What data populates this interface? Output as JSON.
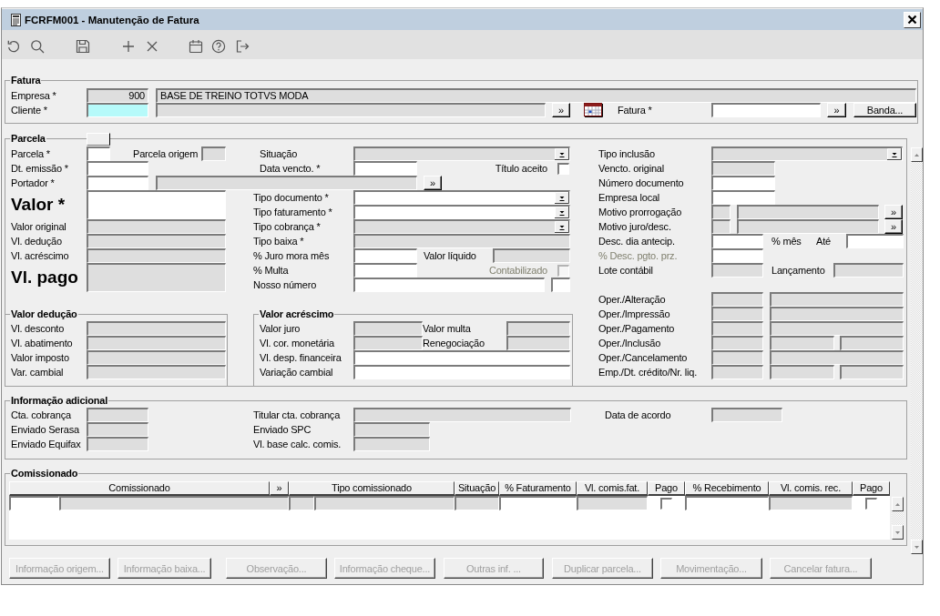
{
  "window": {
    "title": "FCRFM001 - Manutenção de Fatura"
  },
  "fatura": {
    "legend": "Fatura",
    "rows": [
      [
        {
          "kind": "label",
          "text": "Empresa *"
        },
        {
          "kind": "text",
          "value": "900",
          "disabled": true
        },
        {
          "kind": "text",
          "value": "BASE DE TREINO TOTVS MODA",
          "disabled": true
        }
      ],
      [
        {
          "kind": "label",
          "text": "Cliente *"
        },
        {
          "kind": "text",
          "disabled": false,
          "focused": true
        },
        {
          "kind": "text",
          "disabled": true
        },
        {
          "kind": "button",
          "text": "»",
          "disabled": false
        },
        {
          "kind": "calendar"
        },
        {
          "kind": "label",
          "text": "Fatura *"
        },
        {
          "kind": "text",
          "disabled": false
        },
        {
          "kind": "button",
          "text": "»",
          "disabled": false
        },
        {
          "kind": "button",
          "text": "Banda...",
          "disabled": false
        }
      ]
    ]
  },
  "parcela": {
    "legend": "Parcela",
    "left": [
      [
        {
          "kind": "label",
          "text": "Parcela *"
        },
        {
          "kind": "text",
          "disabled": false
        },
        {
          "kind": "label",
          "text": "Parcela origem"
        },
        {
          "kind": "text",
          "disabled": true
        }
      ],
      [
        {
          "kind": "label",
          "text": "Dt. emissão *"
        },
        {
          "kind": "text",
          "disabled": false
        }
      ],
      [
        {
          "kind": "label",
          "text": "Portador *"
        },
        {
          "kind": "text",
          "disabled": false
        },
        {
          "kind": "text",
          "disabled": true
        },
        {
          "kind": "button",
          "text": "»",
          "disabled": false
        }
      ],
      [
        {
          "kind": "heading",
          "text": "Valor *"
        },
        {
          "kind": "text",
          "disabled": false
        }
      ],
      [
        {
          "kind": "label",
          "text": "Valor original"
        },
        {
          "kind": "text",
          "disabled": true
        }
      ],
      [
        {
          "kind": "label",
          "text": "Vl. dedução"
        },
        {
          "kind": "text",
          "disabled": true
        }
      ],
      [
        {
          "kind": "label",
          "text": "Vl. acréscimo"
        },
        {
          "kind": "text",
          "disabled": true
        }
      ],
      [
        {
          "kind": "heading",
          "text": "Vl. pago"
        },
        {
          "kind": "text",
          "disabled": true
        }
      ]
    ],
    "deducao": {
      "legend": "Valor dedução",
      "rows": [
        [
          {
            "kind": "label",
            "text": "Vl. desconto"
          },
          {
            "kind": "text",
            "disabled": true
          }
        ],
        [
          {
            "kind": "label",
            "text": "Vl. abatimento"
          },
          {
            "kind": "text",
            "disabled": true
          }
        ],
        [
          {
            "kind": "label",
            "text": "Valor imposto"
          },
          {
            "kind": "text",
            "disabled": true
          }
        ],
        [
          {
            "kind": "label",
            "text": "Var. cambial"
          },
          {
            "kind": "text",
            "disabled": true
          }
        ]
      ]
    },
    "middle": [
      [
        {
          "kind": "label",
          "text": "Situação"
        },
        {
          "kind": "dropdown",
          "disabled": true
        }
      ],
      [
        {
          "kind": "label",
          "text": "Data vencto. *"
        },
        {
          "kind": "text",
          "disabled": false
        },
        {
          "kind": "label",
          "text": "Título aceito"
        },
        {
          "kind": "checkbox",
          "checked": false,
          "disabled": false
        }
      ],
      [
        {
          "kind": "label",
          "text": "Tipo documento *"
        },
        {
          "kind": "dropdown",
          "disabled": false
        }
      ],
      [
        {
          "kind": "label",
          "text": "Tipo faturamento *"
        },
        {
          "kind": "dropdown",
          "disabled": false
        }
      ],
      [
        {
          "kind": "label",
          "text": "Tipo cobrança *"
        },
        {
          "kind": "dropdown",
          "disabled": true
        }
      ],
      [
        {
          "kind": "label",
          "text": "Tipo baixa *"
        },
        {
          "kind": "text",
          "disabled": true
        }
      ],
      [
        {
          "kind": "label",
          "text": "% Juro mora mês"
        },
        {
          "kind": "text",
          "disabled": false
        },
        {
          "kind": "label",
          "text": "Valor líquido"
        },
        {
          "kind": "text",
          "disabled": true
        }
      ],
      [
        {
          "kind": "label",
          "text": "% Multa"
        },
        {
          "kind": "text",
          "disabled": false
        },
        {
          "kind": "label",
          "text": "Contabilizado",
          "disabled": true
        },
        {
          "kind": "checkbox",
          "checked": false,
          "disabled": true
        }
      ],
      [
        {
          "kind": "label",
          "text": "Nosso número"
        },
        {
          "kind": "text",
          "disabled": false
        },
        {
          "kind": "text",
          "disabled": false
        }
      ]
    ],
    "acrescimo": {
      "legend": "Valor acréscimo",
      "rows": [
        [
          {
            "kind": "label",
            "text": "Valor juro"
          },
          {
            "kind": "text",
            "disabled": true
          },
          {
            "kind": "label",
            "text": "Valor multa"
          },
          {
            "kind": "text",
            "disabled": true
          }
        ],
        [
          {
            "kind": "label",
            "text": "Vl. cor. monetária"
          },
          {
            "kind": "text",
            "disabled": true
          },
          {
            "kind": "label",
            "text": "Renegociação"
          },
          {
            "kind": "text",
            "disabled": true
          }
        ],
        [
          {
            "kind": "label",
            "text": "Vl. desp. financeira"
          },
          {
            "kind": "text",
            "disabled": false
          }
        ],
        [
          {
            "kind": "label",
            "text": "Variação cambial"
          },
          {
            "kind": "text",
            "disabled": false
          }
        ]
      ]
    },
    "right": [
      [
        {
          "kind": "label",
          "text": "Tipo inclusão"
        },
        {
          "kind": "dropdown",
          "disabled": true
        }
      ],
      [
        {
          "kind": "label",
          "text": "Vencto. original"
        },
        {
          "kind": "text",
          "disabled": true
        }
      ],
      [
        {
          "kind": "label",
          "text": "Número documento"
        },
        {
          "kind": "text",
          "disabled": false
        }
      ],
      [
        {
          "kind": "label",
          "text": "Empresa local"
        },
        {
          "kind": "text",
          "disabled": false
        }
      ],
      [
        {
          "kind": "label",
          "text": "Motivo prorrogação"
        },
        {
          "kind": "text",
          "disabled": true
        },
        {
          "kind": "text",
          "disabled": true
        },
        {
          "kind": "button",
          "text": "»",
          "disabled": false
        }
      ],
      [
        {
          "kind": "label",
          "text": "Motivo juro/desc."
        },
        {
          "kind": "text",
          "disabled": true
        },
        {
          "kind": "text",
          "disabled": true
        },
        {
          "kind": "button",
          "text": "»",
          "disabled": false
        }
      ],
      [
        {
          "kind": "label",
          "text": "Desc. dia antecip."
        },
        {
          "kind": "text",
          "disabled": false
        },
        {
          "kind": "label",
          "text": "% mês"
        },
        {
          "kind": "label",
          "text": "Até"
        },
        {
          "kind": "text",
          "disabled": false
        }
      ],
      [
        {
          "kind": "label",
          "text": "% Desc. pgto. prz.",
          "disabled": true
        },
        {
          "kind": "text",
          "disabled": false
        }
      ],
      [
        {
          "kind": "label",
          "text": "Lote contábil"
        },
        {
          "kind": "text",
          "disabled": true
        },
        {
          "kind": "label",
          "text": "Lançamento"
        },
        {
          "kind": "text",
          "disabled": true
        }
      ],
      [
        {
          "kind": "label",
          "text": "Oper./Alteração"
        },
        {
          "kind": "text",
          "disabled": true
        },
        {
          "kind": "text",
          "disabled": true
        }
      ],
      [
        {
          "kind": "label",
          "text": "Oper./Impressão"
        },
        {
          "kind": "text",
          "disabled": true
        },
        {
          "kind": "text",
          "disabled": true
        }
      ],
      [
        {
          "kind": "label",
          "text": "Oper./Pagamento"
        },
        {
          "kind": "text",
          "disabled": true
        },
        {
          "kind": "text",
          "disabled": true
        }
      ],
      [
        {
          "kind": "label",
          "text": "Oper./Inclusão"
        },
        {
          "kind": "text",
          "disabled": true
        },
        {
          "kind": "text",
          "disabled": true
        },
        {
          "kind": "text",
          "disabled": true
        }
      ],
      [
        {
          "kind": "label",
          "text": "Oper./Cancelamento"
        },
        {
          "kind": "text",
          "disabled": true
        },
        {
          "kind": "text",
          "disabled": true
        }
      ],
      [
        {
          "kind": "label",
          "text": "Emp./Dt. crédito/Nr. liq."
        },
        {
          "kind": "text",
          "disabled": true
        },
        {
          "kind": "text",
          "disabled": true
        },
        {
          "kind": "text",
          "disabled": true
        }
      ]
    ]
  },
  "informacao_adicional": {
    "legend": "Informação adicional",
    "rows": [
      [
        {
          "kind": "label",
          "text": "Cta. cobrança"
        },
        {
          "kind": "text",
          "disabled": true
        },
        {
          "kind": "label",
          "text": "Titular cta. cobrança"
        },
        {
          "kind": "text",
          "disabled": true
        },
        {
          "kind": "label",
          "text": "Data de acordo"
        },
        {
          "kind": "text",
          "disabled": true
        }
      ],
      [
        {
          "kind": "label",
          "text": "Enviado Serasa"
        },
        {
          "kind": "text",
          "disabled": true
        },
        {
          "kind": "label",
          "text": "Enviado SPC"
        },
        {
          "kind": "text",
          "disabled": true
        }
      ],
      [
        {
          "kind": "label",
          "text": "Enviado Equifax"
        },
        {
          "kind": "text",
          "disabled": true
        },
        {
          "kind": "label",
          "text": "Vl. base calc. comis."
        },
        {
          "kind": "text",
          "disabled": true
        }
      ]
    ]
  },
  "comissionado": {
    "legend": "Comissionado",
    "columns": [
      "Comissionado",
      "»",
      "Tipo comissionado",
      "Situação",
      "% Faturamento",
      "Vl. comis.fat.",
      "Pago",
      "% Recebimento",
      "Vl. comis. rec.",
      "Pago"
    ],
    "rows": [
      {
        "cells": [
          {
            "kind": "text",
            "disabled": false
          },
          {
            "kind": "text",
            "disabled": true
          },
          {
            "kind": "text",
            "disabled": true
          },
          {
            "kind": "text",
            "disabled": true
          },
          {
            "kind": "text",
            "disabled": true
          },
          {
            "kind": "text",
            "disabled": false
          },
          {
            "kind": "text",
            "disabled": true
          },
          {
            "kind": "checkbox",
            "checked": false,
            "disabled": false
          },
          {
            "kind": "text",
            "disabled": false
          },
          {
            "kind": "text",
            "disabled": true
          },
          {
            "kind": "checkbox",
            "checked": false,
            "disabled": false
          }
        ]
      }
    ]
  },
  "actions": [
    {
      "label": "Informação origem...",
      "disabled": true
    },
    {
      "label": "Informação baixa...",
      "disabled": true
    },
    {
      "label": "Observação...",
      "disabled": true
    },
    {
      "label": "Informação cheque...",
      "disabled": true
    },
    {
      "label": "Outras inf. ...",
      "disabled": true
    },
    {
      "label": "Duplicar parcela...",
      "disabled": true
    },
    {
      "label": "Movimentação...",
      "disabled": true
    },
    {
      "label": "Cancelar fatura...",
      "disabled": true
    }
  ]
}
